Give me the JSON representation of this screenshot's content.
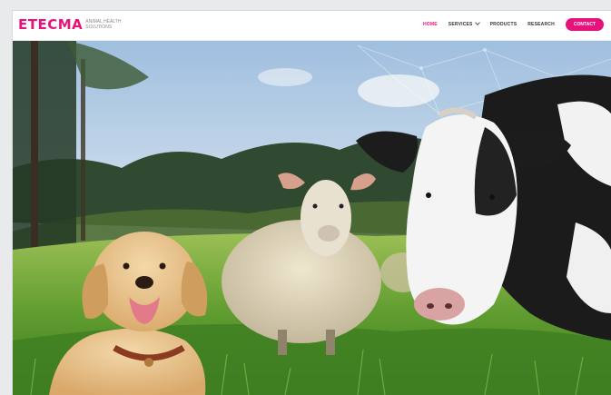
{
  "brand": {
    "name": "ETECMA",
    "tagline": "ANIMAL HEALTH SOLUTIONS"
  },
  "nav": {
    "items": [
      {
        "label": "HOME",
        "active": true,
        "has_dropdown": false
      },
      {
        "label": "SERVICES",
        "active": false,
        "has_dropdown": true
      },
      {
        "label": "PRODUCTS",
        "active": false,
        "has_dropdown": false
      },
      {
        "label": "RESEARCH",
        "active": false,
        "has_dropdown": false
      }
    ],
    "cta_label": "CONTACT"
  },
  "hero": {
    "image_subject": "dog, sheep and cow in a grassy meadow"
  },
  "colors": {
    "accent": "#e8127c",
    "sky": "#b9cfe3",
    "grass": "#5e9a2e",
    "forest": "#2f4a30"
  }
}
